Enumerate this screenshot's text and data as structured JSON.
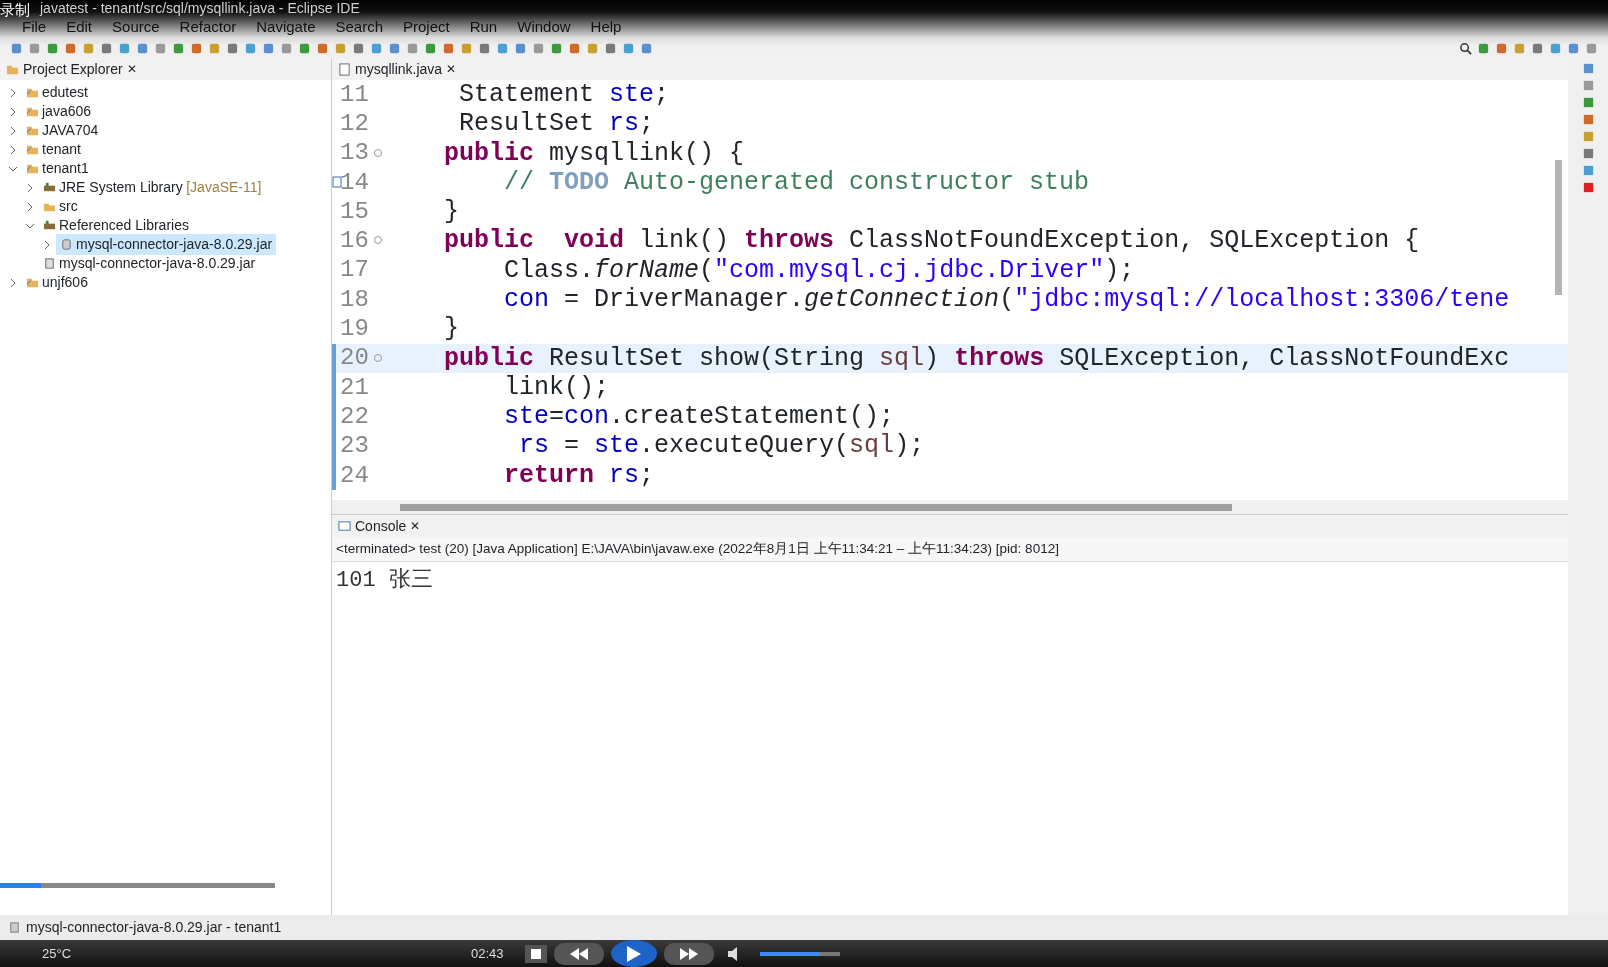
{
  "recorder_label": "录制",
  "window": {
    "title": "javatest - tenant/src/sql/mysqllink.java - Eclipse IDE"
  },
  "menu": [
    "File",
    "Edit",
    "Source",
    "Refactor",
    "Navigate",
    "Search",
    "Project",
    "Run",
    "Window",
    "Help"
  ],
  "project_explorer": {
    "title": "Project Explorer",
    "close": "✕",
    "items": [
      {
        "label": "edutest",
        "kind": "project",
        "expanded": false,
        "selected": false
      },
      {
        "label": "java606",
        "kind": "project",
        "expanded": false,
        "selected": false
      },
      {
        "label": "JAVA704",
        "kind": "project",
        "expanded": false,
        "selected": false
      },
      {
        "label": "tenant",
        "kind": "project",
        "expanded": false,
        "selected": false
      },
      {
        "label": "tenant1",
        "kind": "project",
        "expanded": true,
        "selected": false,
        "children": [
          {
            "label": "JRE System Library",
            "decoration": "[JavaSE-11]",
            "kind": "library",
            "expanded": false,
            "selected": false
          },
          {
            "label": "src",
            "kind": "package",
            "expanded": false,
            "selected": false
          },
          {
            "label": "Referenced Libraries",
            "kind": "library",
            "expanded": true,
            "selected": false,
            "children": [
              {
                "label": "mysql-connector-java-8.0.29.jar",
                "kind": "jar",
                "expanded": false,
                "selected": true
              }
            ]
          },
          {
            "label": "mysql-connector-java-8.0.29.jar",
            "kind": "file",
            "selected": false
          }
        ]
      },
      {
        "label": "unjf606",
        "kind": "project",
        "expanded": false,
        "selected": false
      }
    ]
  },
  "editor": {
    "tab": "mysqllink.java",
    "close": "✕",
    "lines": [
      {
        "number": "11",
        "tokens": [
          {
            "kind": "plain",
            "text": "     Statement "
          },
          {
            "kind": "field",
            "text": "ste"
          },
          {
            "kind": "plain",
            "text": ";"
          }
        ]
      },
      {
        "number": "12",
        "tokens": [
          {
            "kind": "plain",
            "text": "     ResultSet "
          },
          {
            "kind": "field",
            "text": "rs"
          },
          {
            "kind": "plain",
            "text": ";"
          }
        ]
      },
      {
        "number": "13",
        "folding": true,
        "tokens": [
          {
            "kind": "keyword",
            "text": "    public"
          },
          {
            "kind": "plain",
            "text": " mysqllink() {"
          }
        ]
      },
      {
        "number": "14",
        "task": true,
        "tokens": [
          {
            "kind": "comment",
            "text": "        // "
          },
          {
            "kind": "todo",
            "text": "TODO"
          },
          {
            "kind": "comment",
            "text": " Auto-generated constructor stub"
          }
        ]
      },
      {
        "number": "15",
        "tokens": [
          {
            "kind": "plain",
            "text": "    }"
          }
        ]
      },
      {
        "number": "16",
        "folding": true,
        "tokens": [
          {
            "kind": "keyword",
            "text": "    public  void"
          },
          {
            "kind": "plain",
            "text": " link() "
          },
          {
            "kind": "keyword",
            "text": "throws"
          },
          {
            "kind": "plain",
            "text": " ClassNotFoundException, SQLException {"
          }
        ]
      },
      {
        "number": "17",
        "tokens": [
          {
            "kind": "plain",
            "text": "        Class."
          },
          {
            "kind": "method",
            "text": "forName"
          },
          {
            "kind": "plain",
            "text": "("
          },
          {
            "kind": "string",
            "text": "\"com.mysql.cj.jdbc.Driver\""
          },
          {
            "kind": "plain",
            "text": ");"
          }
        ]
      },
      {
        "number": "18",
        "tokens": [
          {
            "kind": "field",
            "text": "        con"
          },
          {
            "kind": "plain",
            "text": " = DriverManager."
          },
          {
            "kind": "method",
            "text": "getConnection"
          },
          {
            "kind": "plain",
            "text": "("
          },
          {
            "kind": "string",
            "text": "\"jdbc:mysql://localhost:3306/tene"
          }
        ]
      },
      {
        "number": "19",
        "tokens": [
          {
            "kind": "plain",
            "text": "    }"
          }
        ]
      },
      {
        "number": "20",
        "folding": true,
        "current": true,
        "tokens": [
          {
            "kind": "keyword",
            "text": "    public"
          },
          {
            "kind": "plain",
            "text": " ResultSet show(String "
          },
          {
            "kind": "param",
            "text": "sql"
          },
          {
            "kind": "plain",
            "text": ") "
          },
          {
            "kind": "keyword",
            "text": "throws"
          },
          {
            "kind": "plain",
            "text": " SQLException, ClassNotFoundExc"
          }
        ]
      },
      {
        "number": "21",
        "range": true,
        "tokens": [
          {
            "kind": "plain",
            "text": "        link();"
          }
        ]
      },
      {
        "number": "22",
        "range": true,
        "tokens": [
          {
            "kind": "field",
            "text": "        ste"
          },
          {
            "kind": "plain",
            "text": "="
          },
          {
            "kind": "field",
            "text": "con"
          },
          {
            "kind": "plain",
            "text": ".createStatement();"
          }
        ]
      },
      {
        "number": "23",
        "range": true,
        "tokens": [
          {
            "kind": "field",
            "text": "         rs"
          },
          {
            "kind": "plain",
            "text": " = "
          },
          {
            "kind": "field",
            "text": "ste"
          },
          {
            "kind": "plain",
            "text": ".executeQuery("
          },
          {
            "kind": "param",
            "text": "sql"
          },
          {
            "kind": "plain",
            "text": ");"
          }
        ]
      },
      {
        "number": "24",
        "range": true,
        "tokens": [
          {
            "kind": "keyword",
            "text": "        return"
          },
          {
            "kind": "field",
            "text": " rs"
          },
          {
            "kind": "plain",
            "text": ";"
          }
        ]
      }
    ]
  },
  "console": {
    "tab": "Console",
    "close": "✕",
    "status": "<terminated> test (20) [Java Application] E:\\JAVA\\bin\\javaw.exe  (2022年8月1日 上午11:34:21 – 上午11:34:23) [pid: 8012]",
    "output": "101 张三"
  },
  "status_bar": "mysql-connector-java-8.0.29.jar - tenant1",
  "video_player": {
    "level": 0.15,
    "time": "02:43",
    "weather": "25°C",
    "volume": {
      "level": 0.75
    }
  }
}
